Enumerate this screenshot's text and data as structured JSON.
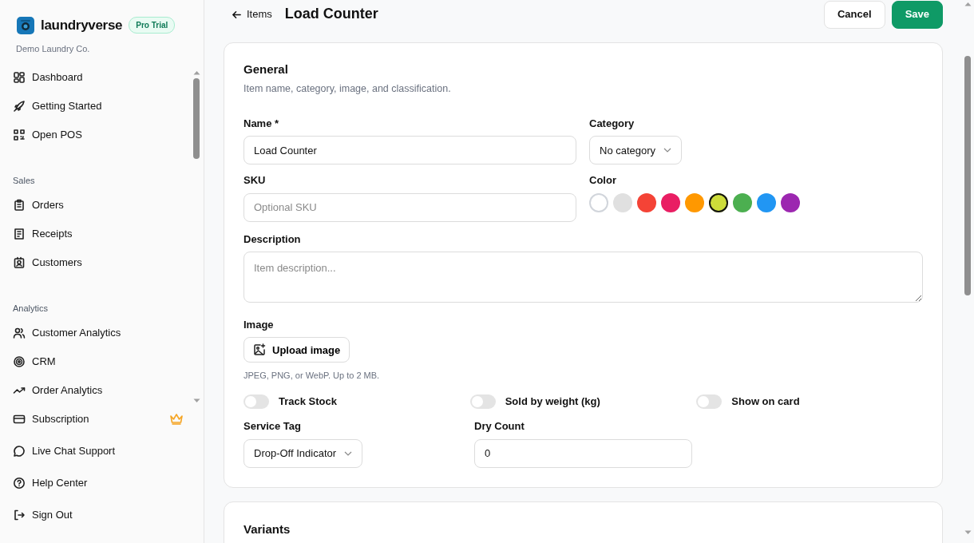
{
  "sidebar": {
    "brand": "laundryverse",
    "badge": "Pro Trial",
    "company": "Demo Laundry Co.",
    "groups": [
      {
        "items": [
          {
            "label": "Dashboard",
            "premium": false
          },
          {
            "label": "Getting Started",
            "premium": false
          },
          {
            "label": "Open POS",
            "premium": false
          }
        ]
      },
      {
        "title": "Sales",
        "items": [
          {
            "label": "Orders",
            "premium": false
          },
          {
            "label": "Receipts",
            "premium": false
          },
          {
            "label": "Customers",
            "premium": false
          }
        ]
      },
      {
        "title": "Analytics",
        "items": [
          {
            "label": "Customer Analytics",
            "premium": false
          },
          {
            "label": "CRM",
            "premium": false
          },
          {
            "label": "Order Analytics",
            "premium": false
          }
        ]
      }
    ],
    "footer": [
      {
        "label": "Subscription",
        "premium": true
      },
      {
        "label": "Live Chat Support",
        "premium": false
      },
      {
        "label": "Help Center",
        "premium": false
      },
      {
        "label": "Sign Out",
        "premium": false
      }
    ]
  },
  "header": {
    "back": "Items",
    "title": "Load Counter",
    "buttons": [
      {
        "label": "Cancel",
        "kind": "secondary"
      },
      {
        "label": "Save",
        "kind": "primary"
      }
    ]
  },
  "general": {
    "title": "General",
    "subtitle": "Item name, category, image, and classification.",
    "name": {
      "label": "Name *",
      "value": "Load Counter"
    },
    "category": {
      "label": "Category",
      "value": "No category"
    },
    "sku": {
      "label": "SKU",
      "placeholder": "Optional SKU"
    },
    "color": {
      "label": "Color",
      "swatches": [
        {
          "color": "#ffffff",
          "selected": false
        },
        {
          "color": "#e0e0e0",
          "selected": false
        },
        {
          "color": "#f44336",
          "selected": false
        },
        {
          "color": "#e91e63",
          "selected": false
        },
        {
          "color": "#ff9800",
          "selected": false
        },
        {
          "color": "#cddc39",
          "selected": true
        },
        {
          "color": "#4caf50",
          "selected": false
        },
        {
          "color": "#2196f3",
          "selected": false
        },
        {
          "color": "#9c27b0",
          "selected": false
        }
      ]
    },
    "description": {
      "label": "Description",
      "placeholder": "Item description..."
    },
    "image": {
      "label": "Image",
      "button": "Upload image",
      "hint": "JPEG, PNG, or WebP. Up to 2 MB."
    },
    "toggles": [
      {
        "label": "Track Stock",
        "on": false
      },
      {
        "label": "Sold by weight (kg)",
        "on": false
      },
      {
        "label": "Show on card",
        "on": false
      }
    ],
    "service_tag": {
      "label": "Service Tag",
      "value": "Drop-Off Indicator"
    },
    "dry_count": {
      "label": "Dry Count",
      "value": "0"
    }
  },
  "variants": {
    "title": "Variants"
  }
}
